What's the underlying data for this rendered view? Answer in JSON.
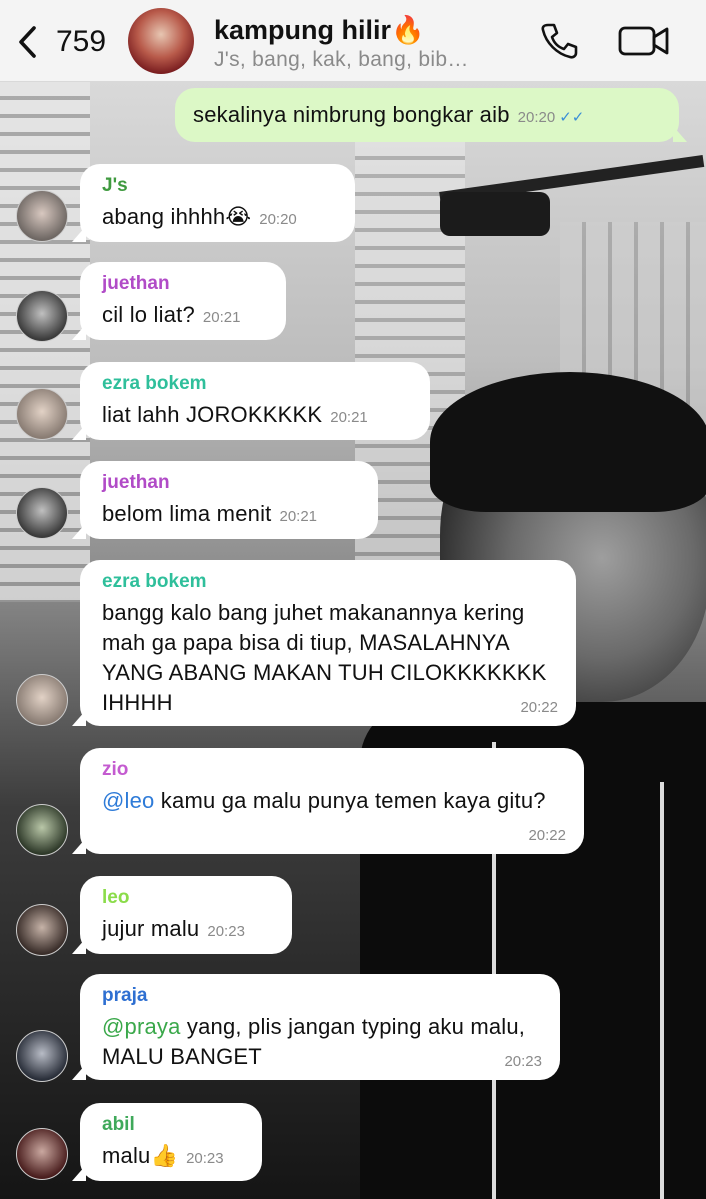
{
  "header": {
    "back_count": "759",
    "title": "kampung hilir🔥",
    "subtitle": "J's, bang, kak, bang, bib…"
  },
  "outgoing": {
    "text": "sekalinya nimbrung bongkar aib",
    "time": "20:20"
  },
  "messages": [
    {
      "sender": "J's",
      "color": "#3f9a3f",
      "text": "abang ihhhh😭",
      "time": "20:20"
    },
    {
      "sender": "juethan",
      "color": "#b14bc7",
      "text": "cil lo liat?",
      "time": "20:21"
    },
    {
      "sender": "ezra bokem",
      "color": "#2fbf9b",
      "text": "liat lahh JOROKKKKK",
      "time": "20:21"
    },
    {
      "sender": "juethan",
      "color": "#b14bc7",
      "text": "belom lima menit",
      "time": "20:21"
    },
    {
      "sender": "ezra bokem",
      "color": "#2fbf9b",
      "text": "bangg kalo bang juhet makanannya kering mah ga papa bisa di tiup, MASALAHNYA YANG ABANG MAKAN TUH CILOKKKKKKK IHHHH",
      "time": "20:22"
    },
    {
      "sender": "zio",
      "color": "#c45bd0",
      "mention": "@leo",
      "text": " kamu ga malu punya temen kaya gitu?",
      "time": "20:22"
    },
    {
      "sender": "leo",
      "color": "#8bdc4a",
      "text": "jujur malu",
      "time": "20:23"
    },
    {
      "sender": "praja",
      "color": "#2e6fd1",
      "mention": "@praya",
      "text": " yang, plis jangan typing aku malu, MALU BANGET",
      "time": "20:23"
    },
    {
      "sender": "abil",
      "color": "#3fa95a",
      "text": "malu👍",
      "time": "20:23"
    }
  ]
}
